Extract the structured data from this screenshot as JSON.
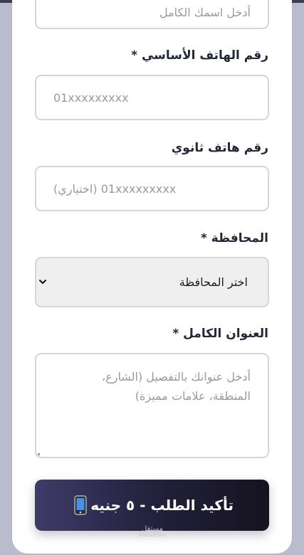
{
  "form": {
    "name_field": {
      "placeholder": "أدخل اسمك الكامل"
    },
    "primary_phone": {
      "label": "رقم الهاتف الأساسي *",
      "placeholder": "01xxxxxxxxx"
    },
    "secondary_phone": {
      "label": "رقم هاتف ثانوي",
      "placeholder": "01xxxxxxxxx (اختياري)"
    },
    "governorate": {
      "label": "المحافظة *",
      "selected": "اختر المحافظة"
    },
    "address": {
      "label": "العنوان الكامل *",
      "placeholder": "أدخل عنوانك بالتفصيل (الشارع، المنطقة، علامات مميزة)"
    },
    "submit": {
      "label": "تأكيد الطلب - ٥ جنيه",
      "icon": "mobile-phone-icon"
    }
  },
  "watermark": {
    "text": "مستقل",
    "subtext": "mostaql.com"
  },
  "colors": {
    "page_background": "#b9bccd",
    "card": "#ffffff",
    "label_text": "#232838",
    "placeholder_text": "#9a9a9a",
    "border": "#d6d6d6",
    "select_background": "#efefef",
    "button_gradient_start": "#3e3c68",
    "button_gradient_end": "#15131f"
  }
}
